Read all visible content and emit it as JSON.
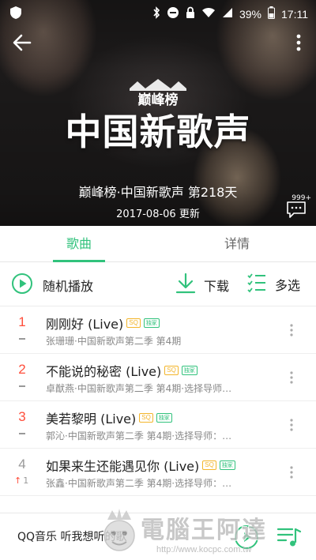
{
  "status_bar": {
    "battery_percent": "39%",
    "time": "17:11"
  },
  "header": {
    "logo_text": "巅峰榜",
    "chart_name": "中国新歌声",
    "subtitle": "巅峰榜·中国新歌声 第218天",
    "updated": "2017-08-06 更新",
    "comment_count": "999+"
  },
  "tabs": [
    {
      "label": "歌曲",
      "active": true
    },
    {
      "label": "详情",
      "active": false
    }
  ],
  "actions": {
    "shuffle_label": "随机播放",
    "download_label": "下载",
    "multiselect_label": "多选"
  },
  "badges": {
    "sq": "SQ",
    "exclusive": "独家"
  },
  "songs": [
    {
      "rank": "1",
      "trend": "flat",
      "title": "刚刚好 (Live)",
      "subtitle": "张珊珊·中国新歌声第二季 第4期",
      "sq": true,
      "exclusive": true
    },
    {
      "rank": "2",
      "trend": "flat",
      "title": "不能说的秘密 (Live)",
      "subtitle": "卓猷燕·中国新歌声第二季 第4期·选择导师…",
      "sq": true,
      "exclusive": true
    },
    {
      "rank": "3",
      "trend": "flat",
      "title": "美若黎明 (Live)",
      "subtitle": "郭沁·中国新歌声第二季 第4期·选择导师：…",
      "sq": true,
      "exclusive": true
    },
    {
      "rank": "4",
      "trend": "up",
      "trend_value": "1",
      "title": "如果来生还能遇见你 (Live)",
      "subtitle": "张鑫·中国新歌声第二季 第4期·选择导师：…",
      "sq": true,
      "exclusive": true
    }
  ],
  "player": {
    "text": "QQ音乐 听我想听的歌"
  },
  "watermark": {
    "text": "電腦王阿達",
    "url": "http://www.kocpc.com.tw"
  },
  "colors": {
    "accent": "#31c27c",
    "rank_top": "#ff4e3b",
    "sq_badge": "#f3b52b"
  }
}
